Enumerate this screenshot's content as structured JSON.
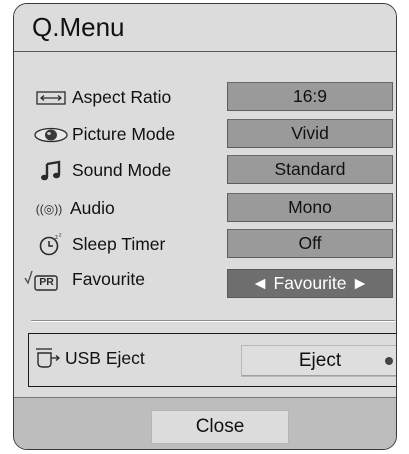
{
  "menu": {
    "title": "Q.Menu",
    "items": [
      {
        "label": "Aspect Ratio",
        "value": "16:9",
        "icon": "aspect-ratio-icon",
        "selected": false
      },
      {
        "label": "Picture Mode",
        "value": "Vivid",
        "icon": "eye-icon",
        "selected": false
      },
      {
        "label": "Sound Mode",
        "value": "Standard",
        "icon": "music-note-icon",
        "selected": false
      },
      {
        "label": "Audio",
        "value": "Mono",
        "icon": "audio-icon",
        "selected": false
      },
      {
        "label": "Sleep Timer",
        "value": "Off",
        "icon": "sleep-timer-icon",
        "selected": false
      },
      {
        "label": "Favourite",
        "value": "◄ Favourite ►",
        "icon": "favourite-pr-icon",
        "selected": true
      }
    ],
    "usb": {
      "label": "USB Eject",
      "button": "Eject",
      "icon": "usb-eject-icon"
    },
    "close": "Close",
    "audio_icon_text": "((◎))",
    "fav_icon_text": "PR"
  }
}
